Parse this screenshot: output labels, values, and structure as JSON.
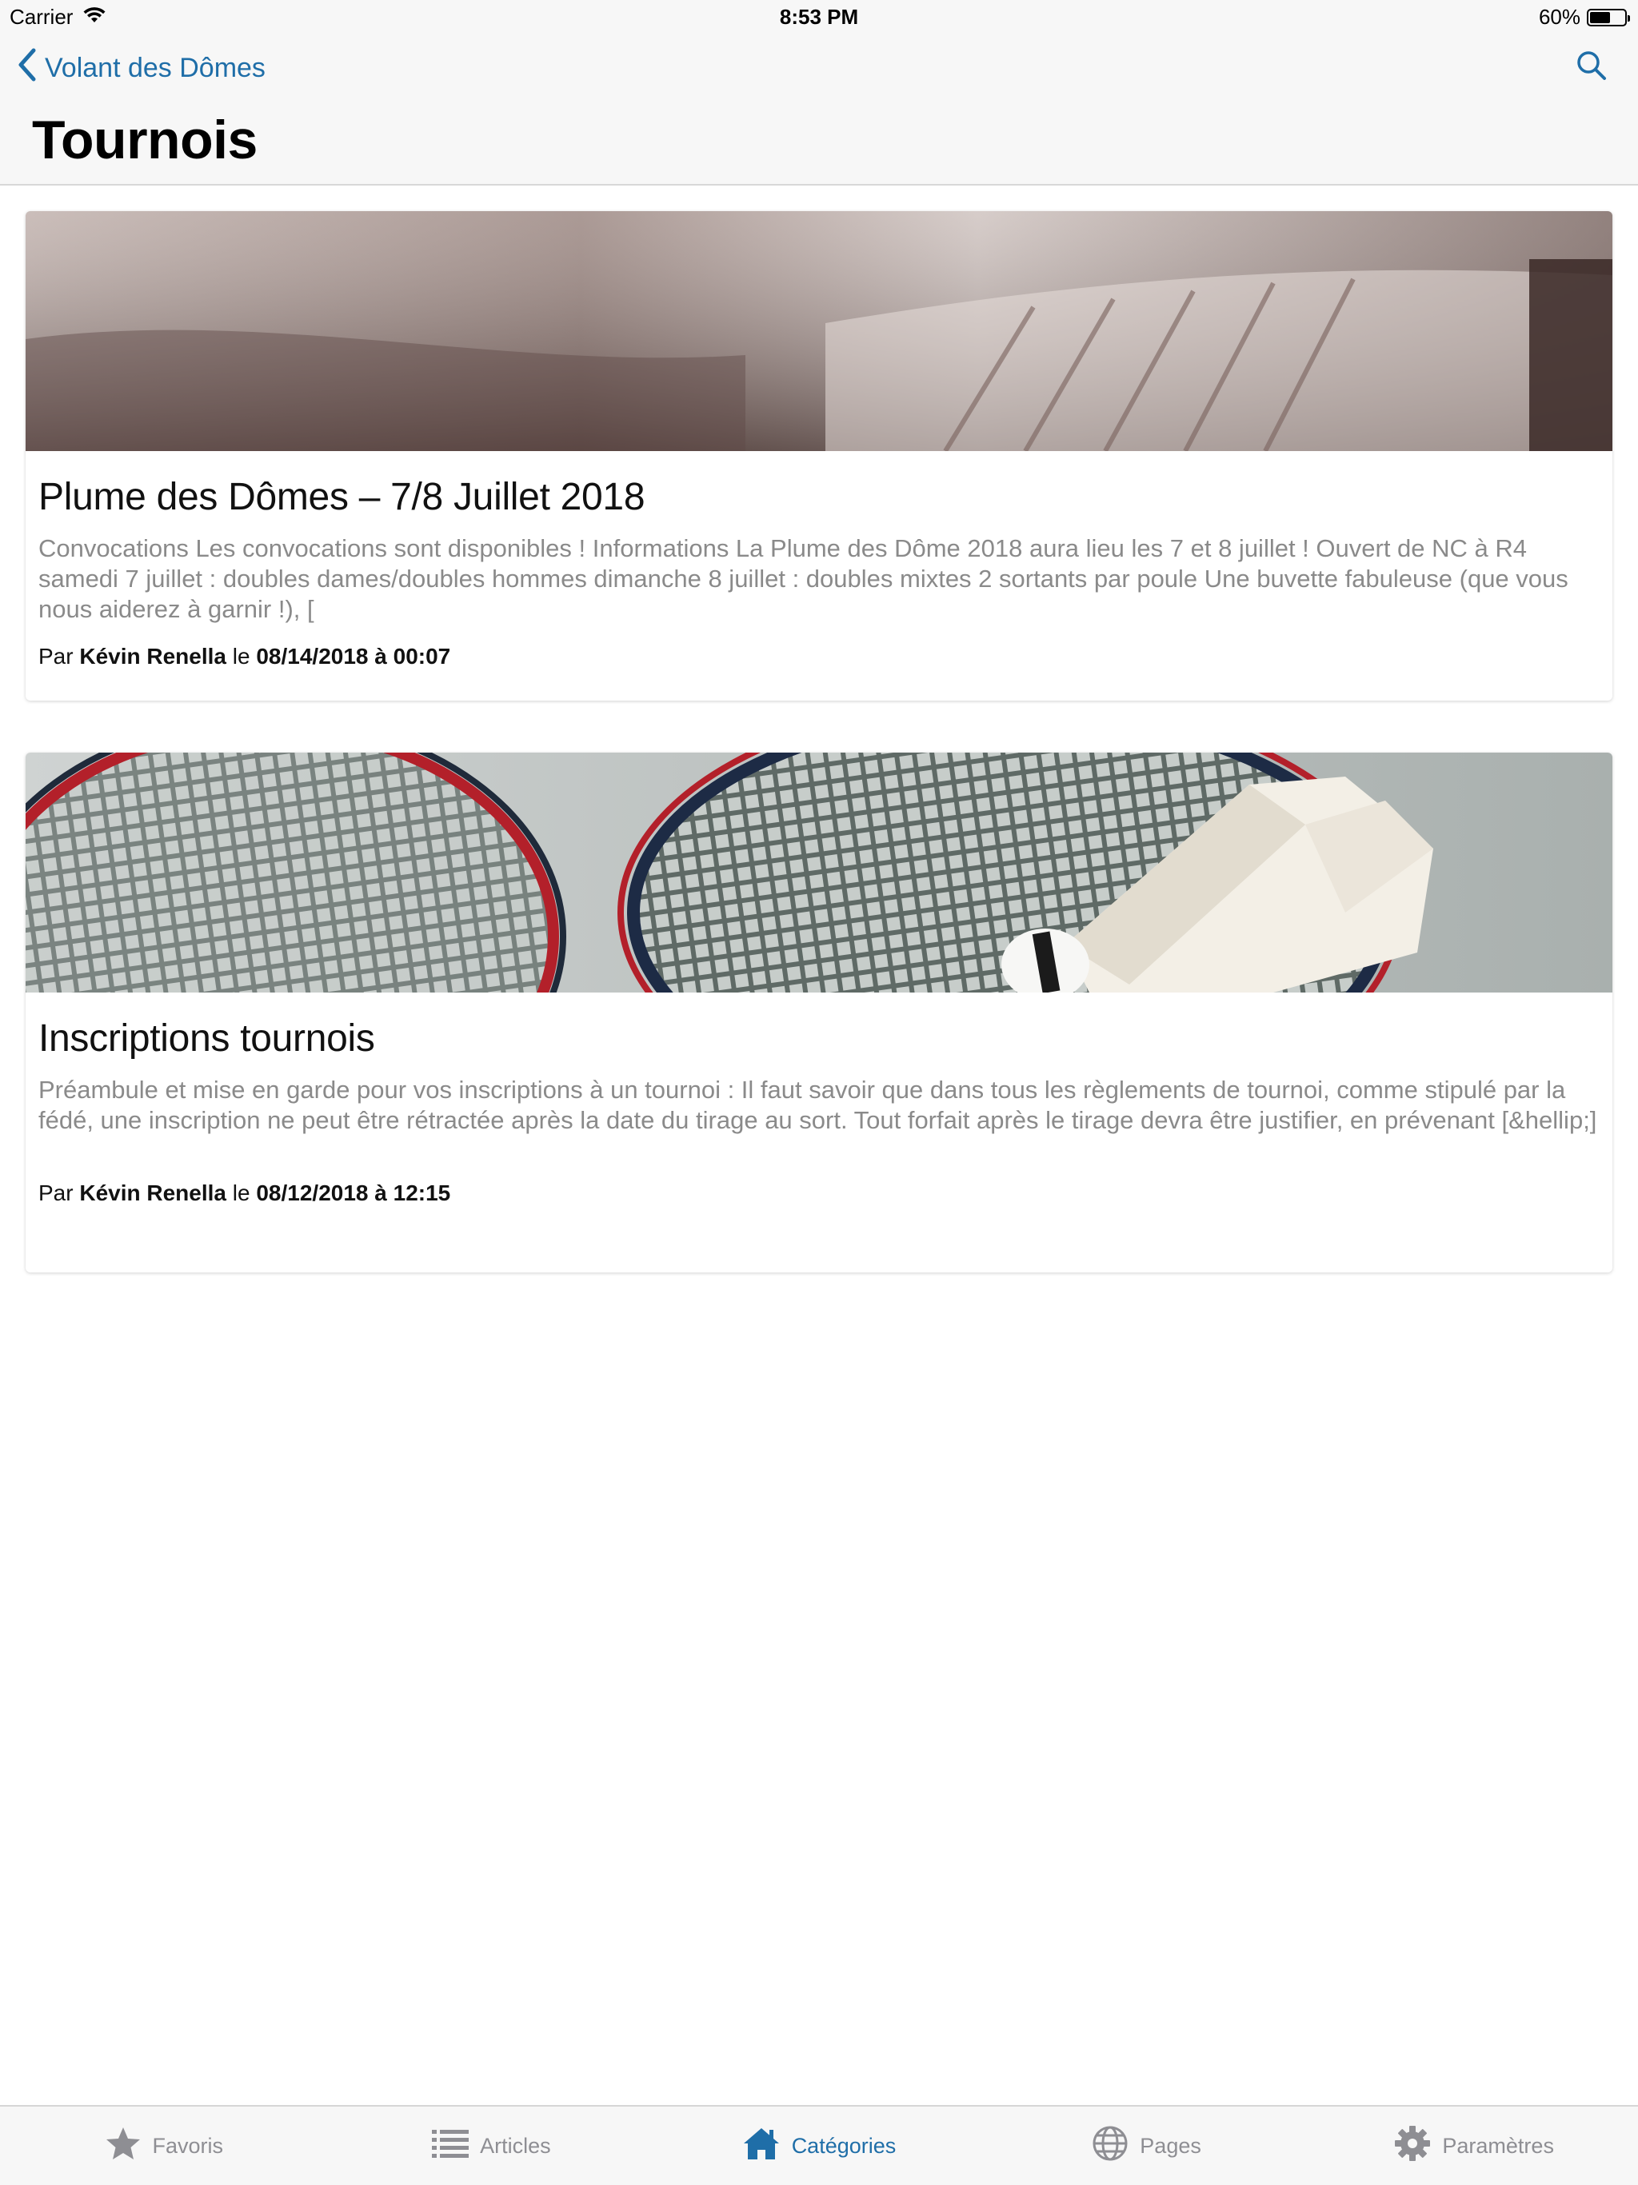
{
  "status_bar": {
    "carrier": "Carrier",
    "time": "8:53 PM",
    "battery_text": "60%",
    "battery_level": 0.6
  },
  "nav": {
    "back_label": "Volant des Dômes",
    "title": "Tournois",
    "accent_color": "#1f6ea8"
  },
  "articles": [
    {
      "title": "Plume des Dômes – 7/8 Juillet 2018",
      "excerpt": "Convocations Les convocations sont disponibles !   Informations La Plume des Dôme 2018 aura lieu les 7 et 8 juillet ! Ouvert de NC à R4 samedi 7 juillet : doubles dames/doubles hommes dimanche 8 juillet : doubles mixtes 2 sortants par poule Une buvette fabuleuse (que vous nous aiderez à garnir !), [",
      "meta_prefix": "Par ",
      "author": "Kévin Renella",
      "meta_mid": " le ",
      "date": "08/14/2018 à 00:07"
    },
    {
      "title": "Inscriptions tournois",
      "excerpt": "Préambule et mise en garde pour vos inscriptions à un tournoi : Il faut savoir que dans tous les règlements de tournoi, comme stipulé par la fédé, une inscription ne peut être rétractée après la date du tirage au sort. Tout forfait après le tirage devra être justifier, en prévenant [&hellip;]",
      "meta_prefix": "Par ",
      "author": "Kévin Renella",
      "meta_mid": " le ",
      "date": "08/12/2018 à 12:15"
    }
  ],
  "tabs": [
    {
      "label": "Favoris",
      "icon": "star-icon",
      "active": false
    },
    {
      "label": "Articles",
      "icon": "list-icon",
      "active": false
    },
    {
      "label": "Catégories",
      "icon": "home-icon",
      "active": true
    },
    {
      "label": "Pages",
      "icon": "globe-icon",
      "active": false
    },
    {
      "label": "Paramètres",
      "icon": "gear-icon",
      "active": false
    }
  ]
}
